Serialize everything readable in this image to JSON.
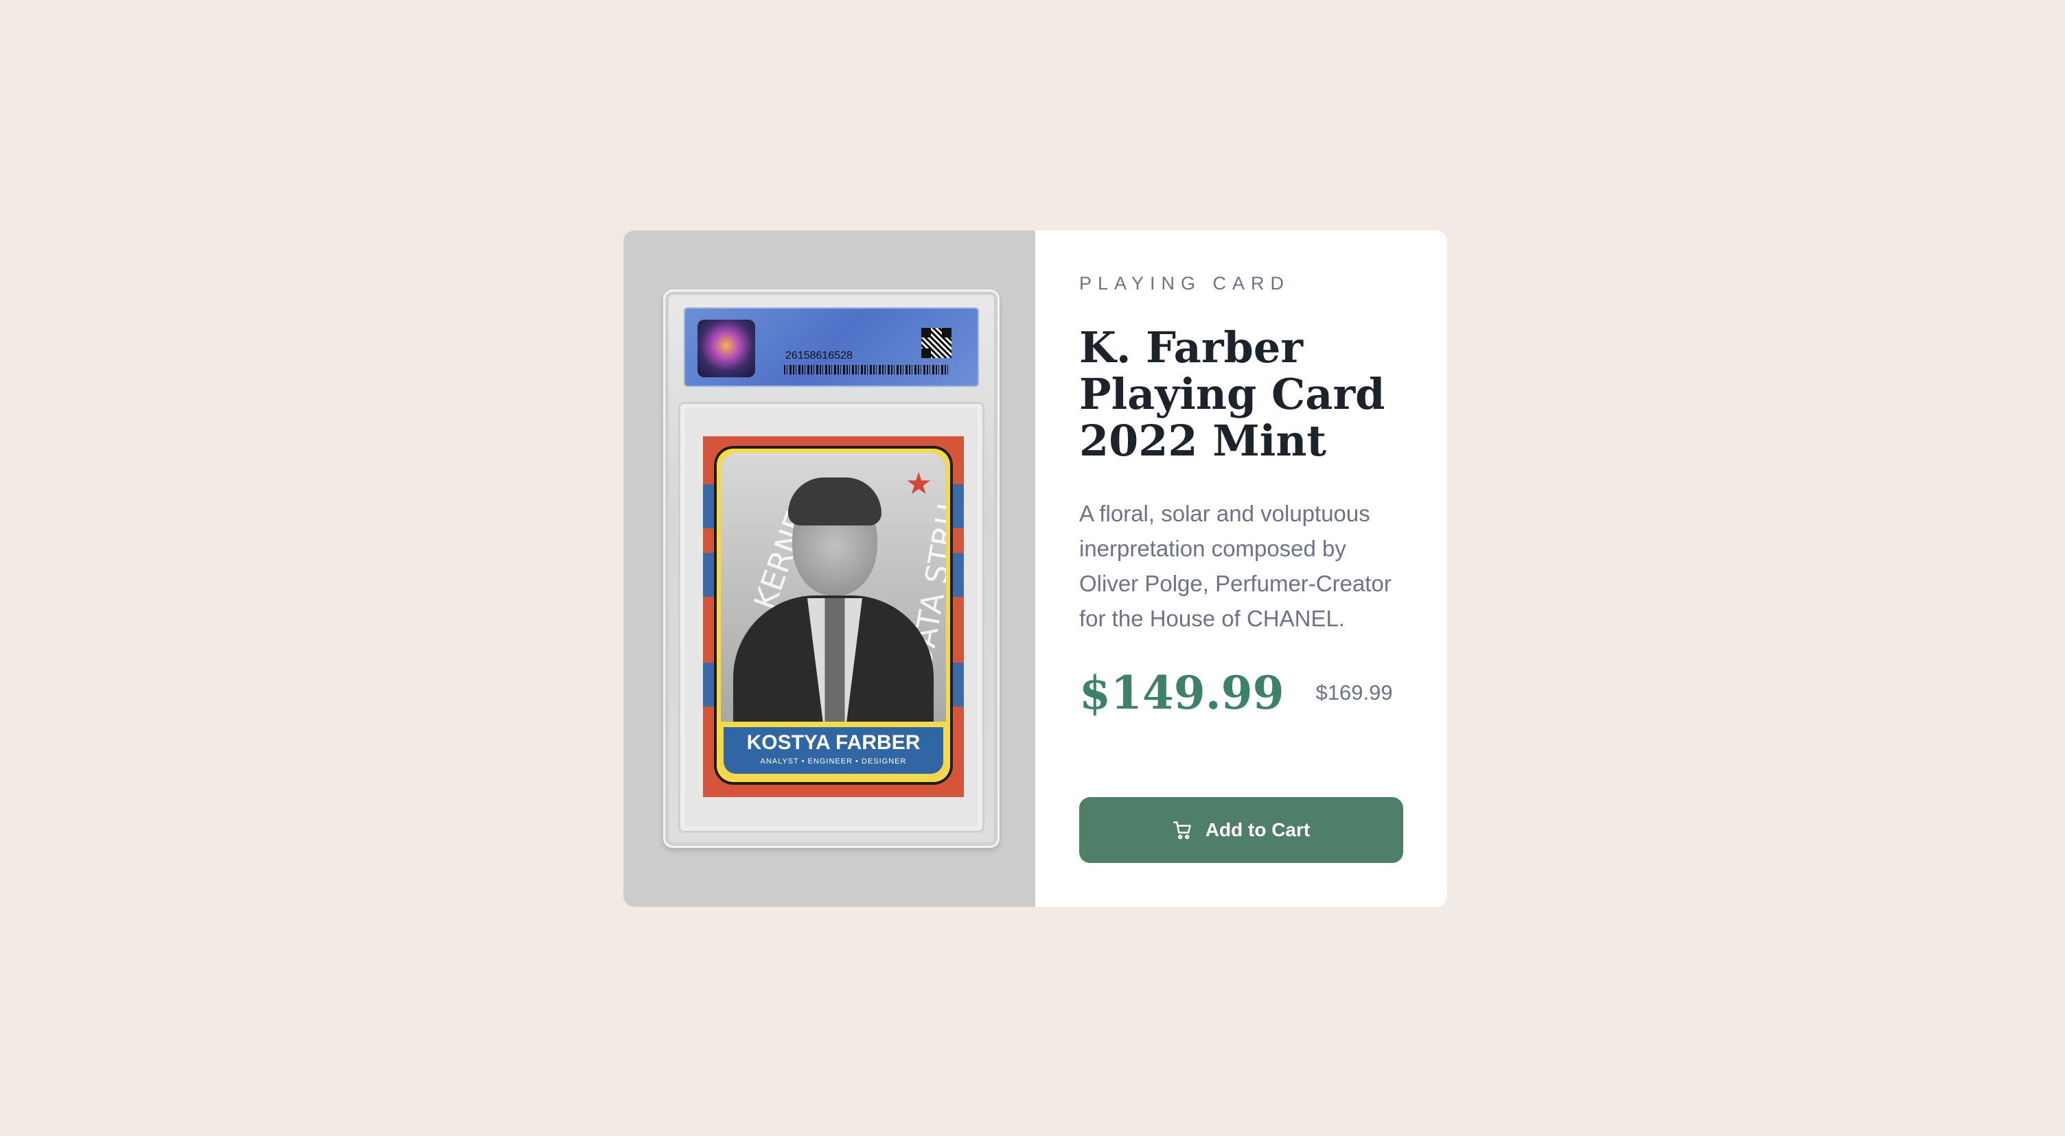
{
  "product": {
    "category": "PLAYING CARD",
    "title": "K. Farber Playing Card 2022 Mint",
    "description": "A floral, solar and voluptuous inerpretation composed by Oliver Polge, Perfumer-Creator for the House of CHANEL.",
    "price": "$149.99",
    "original_price": "$169.99",
    "add_to_cart_label": "Add to Cart"
  },
  "card_image": {
    "cert_number": "26158616528",
    "player_name": "KOSTYA FARBER",
    "player_roles": "ANALYST • ENGINEER • DESIGNER"
  },
  "colors": {
    "background": "#f2ebe5",
    "accent": "#3d8168",
    "button": "#4f7f68",
    "text_muted": "#6c7289",
    "title": "#1c232b"
  },
  "icons": {
    "cart": "cart-icon"
  }
}
